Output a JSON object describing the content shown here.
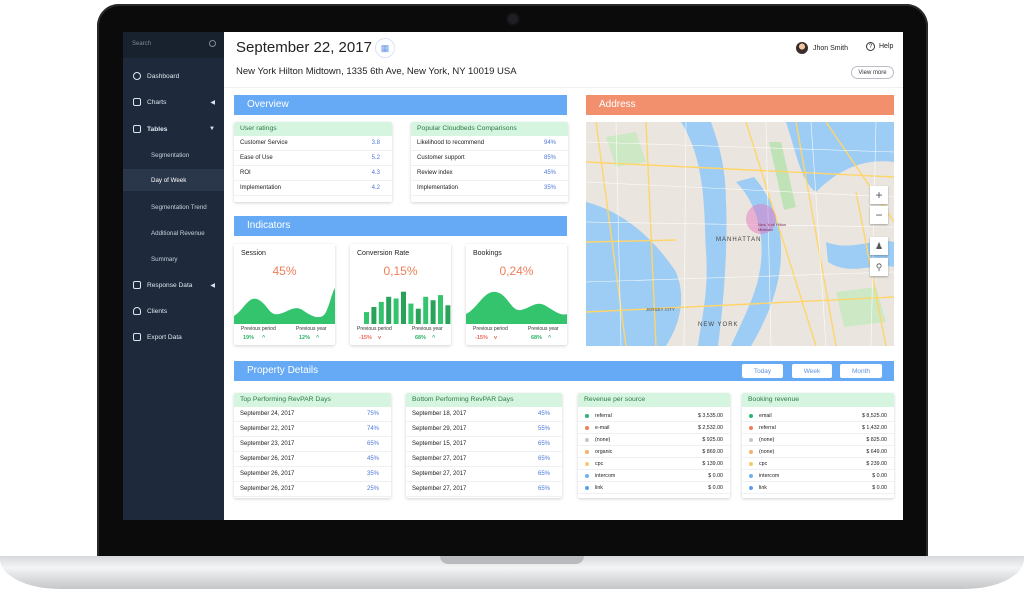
{
  "sidebar": {
    "search_placeholder": "Search",
    "items": [
      {
        "label": "Dashboard",
        "icon": "dashboard-icon"
      },
      {
        "label": "Charts",
        "icon": "charts-icon"
      },
      {
        "label": "Tables",
        "icon": "tables-icon"
      },
      {
        "label": "Response Data",
        "icon": "response-data-icon"
      },
      {
        "label": "Clients",
        "icon": "clients-icon"
      },
      {
        "label": "Export Data",
        "icon": "export-icon"
      }
    ],
    "subitems": [
      "Segmentation",
      "Day of Week",
      "Segmentation Trend",
      "Additional Revenue",
      "Summary"
    ],
    "active_subitem": "Day of Week"
  },
  "header": {
    "date": "September 22, 2017",
    "address": "New York Hilton Midtown,  1335 6th Ave, New York, NY 10019 USA",
    "user": "Jhon Smith",
    "help": "Help",
    "view_more": "View more"
  },
  "overview": {
    "title": "Overview",
    "user_ratings": {
      "title": "User ratings",
      "rows": [
        [
          "Customer Service",
          "3.8"
        ],
        [
          "Ease of Use",
          "5.2"
        ],
        [
          "ROI",
          "4.3"
        ],
        [
          "Implementation",
          "4.2"
        ]
      ]
    },
    "comparisons": {
      "title": "Popular Cloudbeds Comparisons",
      "rows": [
        [
          "Likelihood to recommend",
          "94%"
        ],
        [
          "Customer support",
          "85%"
        ],
        [
          "Review index",
          "45%"
        ],
        [
          "Implementation",
          "35%"
        ]
      ]
    }
  },
  "indicators": {
    "title": "Indicators",
    "cards": [
      {
        "title": "Session",
        "value": "45%",
        "prev_label": "Previous period",
        "prev_value": "19%",
        "prev_dir": "up",
        "year_label": "Previous year",
        "year_value": "12%",
        "year_dir": "up"
      },
      {
        "title": "Conversion Rate",
        "value": "0,15%",
        "prev_label": "Previous period",
        "prev_value": "-15%",
        "prev_dir": "down",
        "year_label": "Previous year",
        "year_value": "68%",
        "year_dir": "up"
      },
      {
        "title": "Bookings",
        "value": "0,24%",
        "prev_label": "Previous period",
        "prev_value": "-15%",
        "prev_dir": "down",
        "year_label": "Previous year",
        "year_value": "68%",
        "year_dir": "up"
      }
    ],
    "conversion_bars": [
      0.35,
      0.5,
      0.65,
      0.8,
      0.75,
      0.95,
      0.6,
      0.45,
      0.8,
      0.7,
      0.85,
      0.55
    ]
  },
  "address_section": {
    "title": "Address",
    "map_labels": {
      "pin": "New York Hilton Midtown",
      "manhattan": "MANHATTAN",
      "new_york": "NEW YORK",
      "jersey": "JERSEY CITY"
    }
  },
  "property": {
    "title": "Property Details",
    "tabs": [
      "Today",
      "Week",
      "Month"
    ],
    "top": {
      "title": "Top Performing RevPAR Days",
      "rows": [
        [
          "September 24, 2017",
          "75%"
        ],
        [
          "September 22, 2017",
          "74%"
        ],
        [
          "September 23, 2017",
          "65%"
        ],
        [
          "September 26, 2017",
          "45%"
        ],
        [
          "September 26, 2017",
          "35%"
        ],
        [
          "September 26, 2017",
          "25%"
        ]
      ]
    },
    "bottom": {
      "title": "Bottom Performing RevPAR Days",
      "rows": [
        [
          "September 18, 2017",
          "45%"
        ],
        [
          "September 29, 2017",
          "55%"
        ],
        [
          "September 15, 2017",
          "65%"
        ],
        [
          "September 27, 2017",
          "65%"
        ],
        [
          "September 27, 2017",
          "65%"
        ],
        [
          "September 27, 2017",
          "65%"
        ]
      ]
    },
    "revenue_source": {
      "title": "Revenue per source",
      "rows": [
        [
          "referral",
          "$ 3,535.00",
          "#2bb673"
        ],
        [
          "e-mail",
          "$ 2,532.00",
          "#ef7e5a"
        ],
        [
          "(none)",
          "$ 925.00",
          "#c3c8cf"
        ],
        [
          "organic",
          "$ 869.00",
          "#f6b26b"
        ],
        [
          "cpc",
          "$ 139.00",
          "#f7c873"
        ],
        [
          "intercom",
          "$ 0.00",
          "#6fb2f0"
        ],
        [
          "link",
          "$ 0.00",
          "#5c9fe6"
        ]
      ]
    },
    "booking_revenue": {
      "title": "Booking revenue",
      "rows": [
        [
          "email",
          "$ 8,525.00",
          "#2bb673"
        ],
        [
          "referral",
          "$ 1,432.00",
          "#ef7e5a"
        ],
        [
          "(none)",
          "$ 825.00",
          "#c3c8cf"
        ],
        [
          "(none)",
          "$ 649.00",
          "#f6b26b"
        ],
        [
          "cpc",
          "$ 239.00",
          "#f7c873"
        ],
        [
          "intercom",
          "$ 0.00",
          "#6fb2f0"
        ],
        [
          "link",
          "$ 0.00",
          "#5c9fe6"
        ]
      ]
    }
  }
}
